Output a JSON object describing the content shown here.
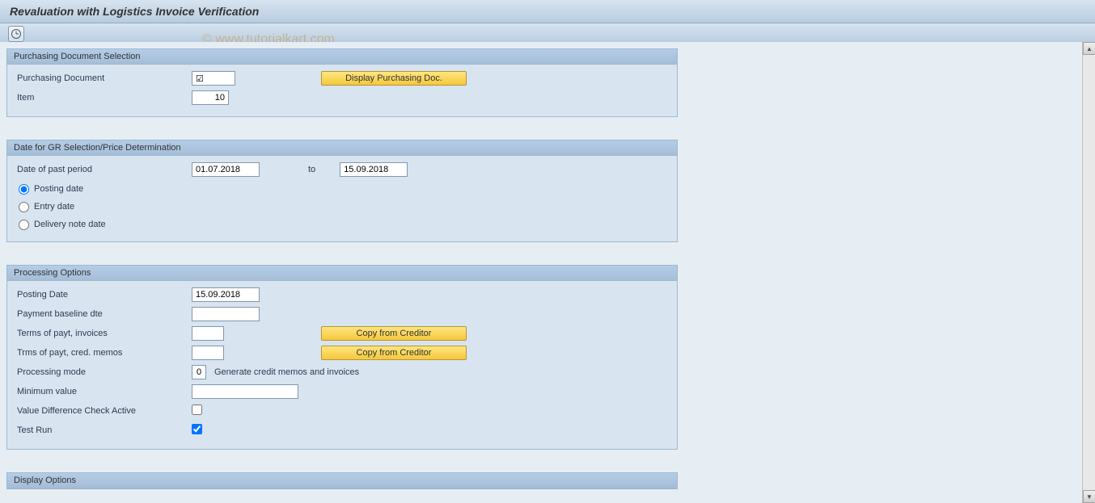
{
  "header": {
    "title": "Revaluation with Logistics Invoice Verification"
  },
  "watermark": "© www.tutorialkart.com",
  "section1": {
    "title": "Purchasing Document Selection",
    "purchasing_doc_label": "Purchasing Document",
    "purchasing_doc_value": "☑",
    "item_label": "Item",
    "item_value": "10",
    "display_button": "Display Purchasing Doc."
  },
  "section2": {
    "title": "Date for GR Selection/Price Determination",
    "date_past_label": "Date of past period",
    "date_from": "01.07.2018",
    "to_label": "to",
    "date_to": "15.09.2018",
    "radio_posting": "Posting date",
    "radio_entry": "Entry date",
    "radio_delivery": "Delivery note date"
  },
  "section3": {
    "title": "Processing Options",
    "posting_date_label": "Posting Date",
    "posting_date_value": "15.09.2018",
    "payment_baseline_label": "Payment baseline dte",
    "payment_baseline_value": "",
    "terms_inv_label": "Terms of payt, invoices",
    "terms_inv_value": "",
    "copy_btn1": "Copy from Creditor",
    "terms_cred_label": "Trms of payt, cred. memos",
    "terms_cred_value": "",
    "copy_btn2": "Copy from Creditor",
    "proc_mode_label": "Processing mode",
    "proc_mode_value": "0",
    "proc_mode_text": "Generate credit memos and invoices",
    "min_value_label": "Minimum value",
    "min_value_value": "",
    "val_diff_label": "Value Difference Check Active",
    "test_run_label": "Test Run"
  },
  "section4": {
    "title": "Display Options"
  }
}
